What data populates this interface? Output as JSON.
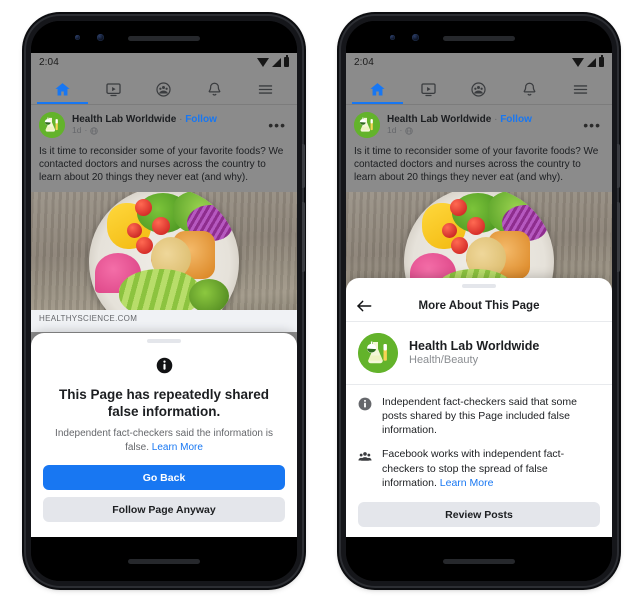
{
  "theme": {
    "fb_blue": "#1877F2",
    "avatar_green": "#63b32b",
    "dim_overlay": "#8b8b8b",
    "button_secondary": "#e4e6eb",
    "text_primary": "#1c1e21",
    "text_secondary": "#65676b"
  },
  "status_bar": {
    "clock": "2:04",
    "icons": [
      "wifi-icon",
      "cellular-signal-icon",
      "battery-icon"
    ]
  },
  "nav_tabs": [
    {
      "name": "home-tab",
      "icon": "home-icon",
      "active": true
    },
    {
      "name": "watch-tab",
      "icon": "video-screen-icon",
      "active": false
    },
    {
      "name": "groups-tab",
      "icon": "groups-icon",
      "active": false
    },
    {
      "name": "notifications-tab",
      "icon": "bell-icon",
      "active": false
    },
    {
      "name": "menu-tab",
      "icon": "hamburger-menu-icon",
      "active": false
    }
  ],
  "post": {
    "page_name": "Health Lab Worldwide",
    "separator": "·",
    "follow_label": "Follow",
    "timestamp": "1d",
    "audience_icon": "globe-icon",
    "more_options": "•••",
    "body": "Is it time to reconsider some of your favorite foods? We contacted doctors and nurses across the country to learn about 20 things they never eat (and why).",
    "photo_alt": "salad-bowl-photo",
    "link_domain": "HEALTHYSCIENCE.COM"
  },
  "left_phone": {
    "sheet": {
      "name": "false-information-warning-sheet",
      "icon": "info-circle-icon",
      "title": "This Page has repeatedly shared false information.",
      "subtitle_text": "Independent fact-checkers said the information is false.",
      "subtitle_link": "Learn More",
      "primary_button": "Go Back",
      "secondary_button": "Follow Page Anyway"
    }
  },
  "right_phone": {
    "sheet": {
      "name": "more-about-this-page-sheet",
      "back_icon": "back-arrow-icon",
      "title": "More About This Page",
      "page": {
        "avatar": "health-lab-avatar",
        "name": "Health Lab Worldwide",
        "category": "Health/Beauty"
      },
      "facts": [
        {
          "icon": "info-circle-icon",
          "text": "Independent fact-checkers said that some posts shared by this Page included false information.",
          "link": ""
        },
        {
          "icon": "fact-checkers-group-icon",
          "text": "Facebook works with independent fact-checkers to stop the spread of false information.",
          "link": "Learn More"
        }
      ],
      "action_button": "Review Posts"
    }
  }
}
